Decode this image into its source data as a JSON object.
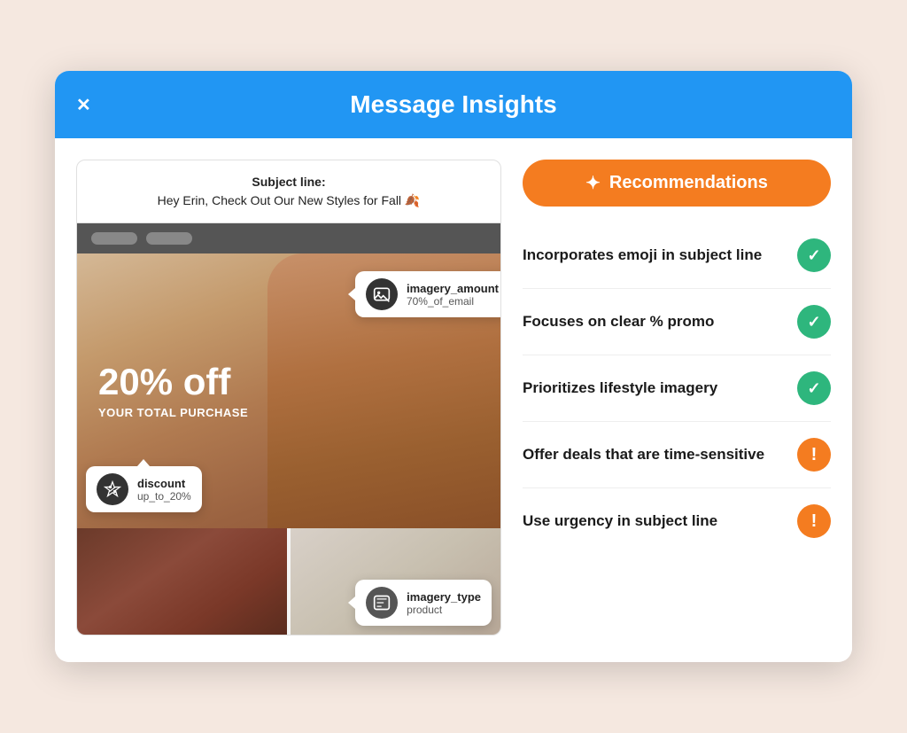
{
  "modal": {
    "title": "Message Insights",
    "close_label": "✕"
  },
  "subject_line": {
    "label": "Subject line:",
    "text": "Hey Erin, Check Out Our New Styles for Fall 🍂"
  },
  "email_preview": {
    "discount_text": "20% off",
    "purchase_text": "YOUR TOTAL PURCHASE"
  },
  "tooltips": {
    "imagery": {
      "label": "imagery_amount",
      "value": "70%_of_email"
    },
    "discount": {
      "label": "discount",
      "value": "up_to_20%"
    },
    "imagery_type": {
      "label": "imagery_type",
      "value": "product"
    }
  },
  "recommendations": {
    "button_label": "Recommendations",
    "items": [
      {
        "id": "emoji",
        "label": "Incorporates emoji in subject line",
        "status": "green"
      },
      {
        "id": "promo",
        "label": "Focuses on clear % promo",
        "status": "green"
      },
      {
        "id": "lifestyle",
        "label": "Prioritizes lifestyle imagery",
        "status": "green"
      },
      {
        "id": "deals",
        "label": "Offer deals that are time-sensitive",
        "status": "orange"
      },
      {
        "id": "urgency",
        "label": "Use urgency in subject line",
        "status": "orange"
      }
    ]
  }
}
